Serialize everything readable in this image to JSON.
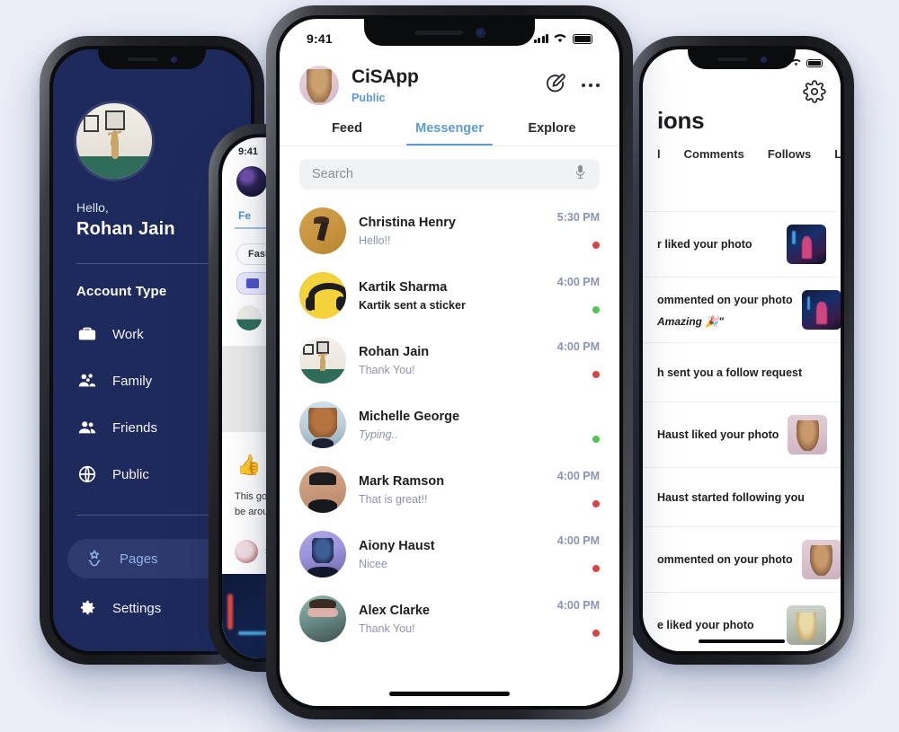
{
  "background_color": "#eaeef7",
  "left_phone": {
    "name": "navigation-drawer",
    "screen_bg": "#1f2a5c",
    "greeting": "Hello,",
    "username": "Rohan Jain",
    "section_title": "Account Type",
    "nav_items": [
      {
        "label": "Work",
        "icon": "briefcase-icon",
        "active": false
      },
      {
        "label": "Family",
        "icon": "family-group-icon",
        "active": false
      },
      {
        "label": "Friends",
        "icon": "friends-group-icon",
        "active": false
      },
      {
        "label": "Public",
        "icon": "globe-icon",
        "active": false
      }
    ],
    "bottom_items": [
      {
        "label": "Pages",
        "icon": "pages-star-icon",
        "active": true
      },
      {
        "label": "Settings",
        "icon": "gear-icon",
        "active": false
      }
    ],
    "active_pill_color": "#2e3a6e",
    "active_text_color": "#8fb4e8"
  },
  "hidden_phone": {
    "name": "feed-screen-partial",
    "status_time": "9:41",
    "tab_label": "Fe",
    "chip_label": "Fashi",
    "caption_line1": "This goe",
    "caption_line2": "be aroun",
    "row_label": "S"
  },
  "center_phone": {
    "name": "messenger-screen",
    "status": {
      "time": "9:41",
      "signal_icon": "cellular-bars-icon",
      "wifi_icon": "wifi-icon",
      "battery_icon": "battery-icon"
    },
    "header": {
      "avatar": "profile-avatar",
      "title": "CiSApp",
      "subtitle": "Public",
      "subtitle_color": "#5b9bd5",
      "compose_icon": "compose-pencil-icon",
      "more_icon": "more-dots-icon"
    },
    "tabs": [
      {
        "label": "Feed",
        "active": false
      },
      {
        "label": "Messenger",
        "active": true
      },
      {
        "label": "Explore",
        "active": false
      }
    ],
    "accent_color": "#5b9bd5",
    "search": {
      "placeholder": "Search",
      "value": "",
      "mic_icon": "microphone-icon"
    },
    "chats": [
      {
        "name": "Christina Henry",
        "preview": "Hello!!",
        "time": "5:30 PM",
        "status_color": "#d64545",
        "unread": false,
        "typing": false,
        "avatar": "cav-umbrella"
      },
      {
        "name": "Kartik Sharma",
        "preview": "Kartik sent a sticker",
        "time": "4:00 PM",
        "status_color": "#52c25a",
        "unread": true,
        "typing": false,
        "avatar": "cav-head"
      },
      {
        "name": "Rohan Jain",
        "preview": "Thank You!",
        "time": "4:00 PM",
        "status_color": "#d64545",
        "unread": false,
        "typing": false,
        "avatar": "cav-plant"
      },
      {
        "name": "Michelle George",
        "preview": "Typing..",
        "time": "",
        "status_color": "#52c25a",
        "unread": false,
        "typing": true,
        "avatar": "cav-girl"
      },
      {
        "name": "Mark Ramson",
        "preview": "That is great!!",
        "time": "4:00 PM",
        "status_color": "#d64545",
        "unread": false,
        "typing": false,
        "avatar": "cav-mark"
      },
      {
        "name": "Aiony Haust",
        "preview": "Nicee",
        "time": "4:00 PM",
        "status_color": "#d64545",
        "unread": false,
        "typing": false,
        "avatar": "cav-aiony"
      },
      {
        "name": "Alex Clarke",
        "preview": "Thank You!",
        "time": "4:00 PM",
        "status_color": "#d64545",
        "unread": false,
        "typing": false,
        "avatar": "cav-alex"
      }
    ]
  },
  "right_phone": {
    "name": "notifications-screen",
    "settings_icon": "gear-icon",
    "title": "ions",
    "tabs": [
      "l",
      "Comments",
      "Follows",
      "Li"
    ],
    "notifications": [
      {
        "text": "r liked your photo",
        "sub": "",
        "thumb": "th-concert"
      },
      {
        "text": "ommented on your photo",
        "sub": "Amazing 🎉\"",
        "thumb": "th-concert"
      },
      {
        "text": "h sent you a follow request",
        "sub": "",
        "thumb": ""
      },
      {
        "text": "Haust liked your photo",
        "sub": "",
        "thumb": "th-girl"
      },
      {
        "text": "Haust started following you",
        "sub": "",
        "thumb": ""
      },
      {
        "text": "ommented on your photo",
        "sub": "",
        "thumb": "th-girl"
      },
      {
        "text": "e liked your photo",
        "sub": "",
        "thumb": "th-blonde"
      }
    ]
  }
}
